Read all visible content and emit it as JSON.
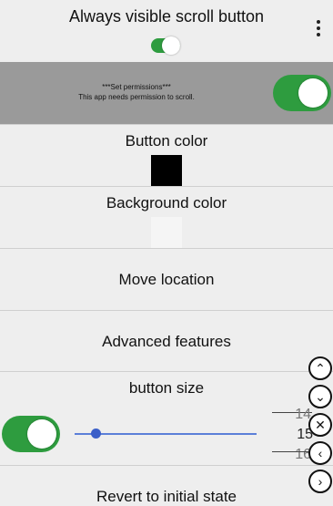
{
  "header": {
    "title": "Always visible scroll button",
    "menu_icon": "more-vert-icon",
    "visible_toggle_on": true
  },
  "permission": {
    "line1": "***Set permissions***",
    "line2": "This app needs permission to scroll.",
    "toggle_on": true
  },
  "settings": {
    "button_color_label": "Button color",
    "button_color": "#000000",
    "background_color_label": "Background color",
    "background_color": "#f5f5f5",
    "move_location_label": "Move location",
    "advanced_label": "Advanced features",
    "button_size_label": "button size",
    "button_size_toggle_on": true,
    "slider_value": 0.1,
    "revert_label": "Revert to initial state"
  },
  "size_picker": {
    "prev": "14",
    "current": "15",
    "next": "16"
  },
  "floating_controls": [
    {
      "name": "scroll-up-icon",
      "glyph": "⌃"
    },
    {
      "name": "scroll-down-icon",
      "glyph": "⌄"
    },
    {
      "name": "close-icon",
      "glyph": "✕"
    },
    {
      "name": "scroll-left-icon",
      "glyph": "‹"
    },
    {
      "name": "scroll-right-icon",
      "glyph": "›"
    }
  ],
  "colors": {
    "toggle_on": "#2e9c3f",
    "permission_bg": "#9a9a9a",
    "slider": "#3b5fc8"
  }
}
